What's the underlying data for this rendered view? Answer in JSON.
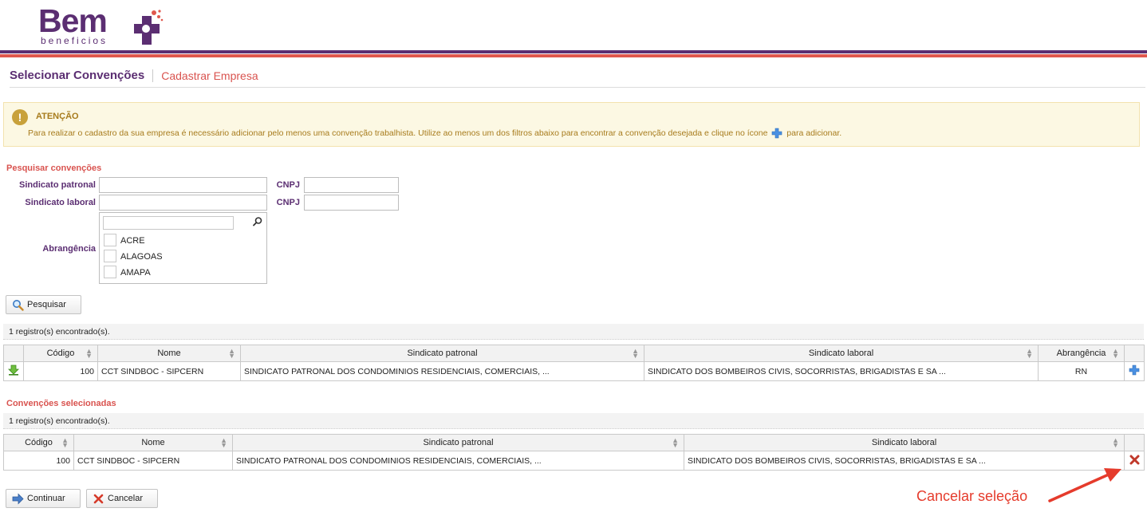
{
  "header": {
    "logo_text": "Bem",
    "logo_subtext": "beneficios",
    "colors": {
      "brand_purple": "#5b2e72",
      "brand_red": "#e0574d",
      "accent_blue": "#4a90e2"
    }
  },
  "page": {
    "title": "Selecionar Convenções",
    "link": "Cadastrar Empresa"
  },
  "alert": {
    "icon": "exclamation-icon",
    "title": "ATENÇÃO",
    "text_before": "Para realizar o cadastro da sua empresa é necessário adicionar pelo menos uma convenção trabalhista. Utilize ao menos um dos filtros abaixo para encontrar a convenção desejada e clique no ícone",
    "text_after": "para adicionar."
  },
  "search": {
    "section_title": "Pesquisar convenções",
    "labels": {
      "sindicato_patronal": "Sindicato patronal",
      "sindicato_laboral": "Sindicato laboral",
      "cnpj": "CNPJ",
      "abrangencia": "Abrangência"
    },
    "values": {
      "sindicato_patronal": "",
      "cnpj_patronal": "",
      "sindicato_laboral": "",
      "cnpj_laboral": "",
      "abrangencia_filter": ""
    },
    "abrangencia_options": [
      "ACRE",
      "ALAGOAS",
      "AMAPA"
    ],
    "search_button": "Pesquisar"
  },
  "results": {
    "count_text": "1 registro(s) encontrado(s).",
    "columns": [
      "Código",
      "Nome",
      "Sindicato patronal",
      "Sindicato laboral",
      "Abrangência"
    ],
    "rows": [
      {
        "codigo": "100",
        "nome": "CCT SINDBOC - SIPCERN",
        "sindicato_patronal": "SINDICATO PATRONAL DOS CONDOMINIOS RESIDENCIAIS, COMERCIAIS, ...",
        "sindicato_laboral": "SINDICATO DOS BOMBEIROS CIVIS, SOCORRISTAS, BRIGADISTAS E SA ...",
        "abrangencia": "RN"
      }
    ]
  },
  "selected": {
    "section_title": "Convenções selecionadas",
    "count_text": "1 registro(s) encontrado(s).",
    "columns": [
      "Código",
      "Nome",
      "Sindicato patronal",
      "Sindicato laboral"
    ],
    "rows": [
      {
        "codigo": "100",
        "nome": "CCT SINDBOC - SIPCERN",
        "sindicato_patronal": "SINDICATO PATRONAL DOS CONDOMINIOS RESIDENCIAIS, COMERCIAIS, ...",
        "sindicato_laboral": "SINDICATO DOS BOMBEIROS CIVIS, SOCORRISTAS, BRIGADISTAS E SA ..."
      }
    ]
  },
  "actions": {
    "continue_button": "Continuar",
    "cancel_button": "Cancelar"
  },
  "annotation": {
    "text": "Cancelar seleção",
    "color": "#e53b2c"
  }
}
